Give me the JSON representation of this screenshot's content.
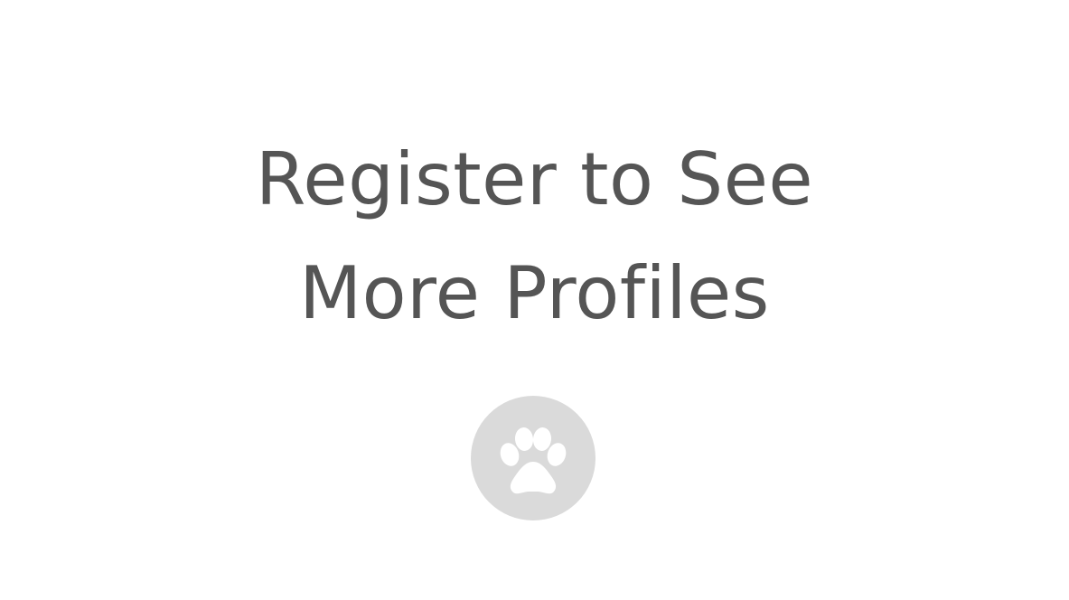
{
  "headline": {
    "line1": "Register to See",
    "line2": "More Profiles"
  },
  "badge": {
    "icon": "paw-icon",
    "background_color": "#dadada",
    "icon_color": "#ffffff"
  },
  "colors": {
    "text": "#555555",
    "page_background": "#ffffff"
  }
}
